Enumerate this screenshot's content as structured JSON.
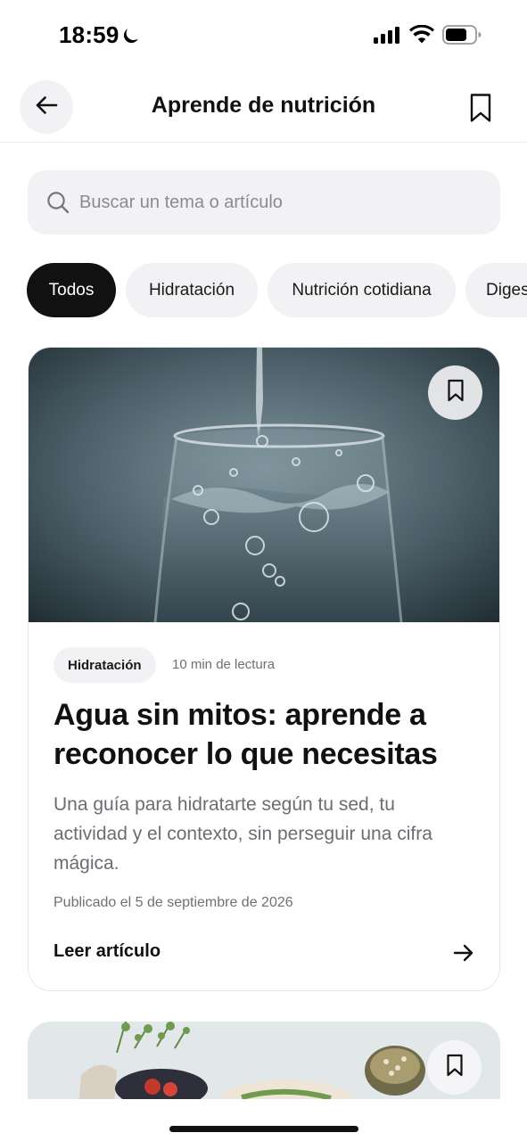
{
  "status_bar": {
    "time": "18:59",
    "icons": [
      "moon-icon",
      "cellular-signal-icon",
      "wifi-icon",
      "battery-icon"
    ]
  },
  "header": {
    "title": "Aprende de nutrición",
    "back_icon": "arrow-left-icon",
    "bookmark_icon": "bookmark-icon"
  },
  "search": {
    "placeholder": "Buscar un tema o artículo",
    "value": ""
  },
  "categories": [
    {
      "label": "Todos",
      "selected": true
    },
    {
      "label": "Hidratación",
      "selected": false
    },
    {
      "label": "Nutrición cotidiana",
      "selected": false
    },
    {
      "label": "Diges",
      "selected": false
    }
  ],
  "featured_article": {
    "tag": "Hidratación",
    "read_time": "10 min de lectura",
    "title": "Agua sin mitos: aprende a reconocer lo que necesitas",
    "description": "Una guía para hidratarte según tu sed, tu actividad y el contexto, sin perseguir una cifra mágica.",
    "published": "Publicado el 5 de septiembre de 2026",
    "link_label": "Leer artículo",
    "image": "water-glass-photo"
  },
  "second_article": {
    "image": "food-table-photo"
  },
  "colors": {
    "accent_chip": "#111111",
    "chip_bg": "#f2f2f5",
    "muted_text": "#6c6c72"
  }
}
